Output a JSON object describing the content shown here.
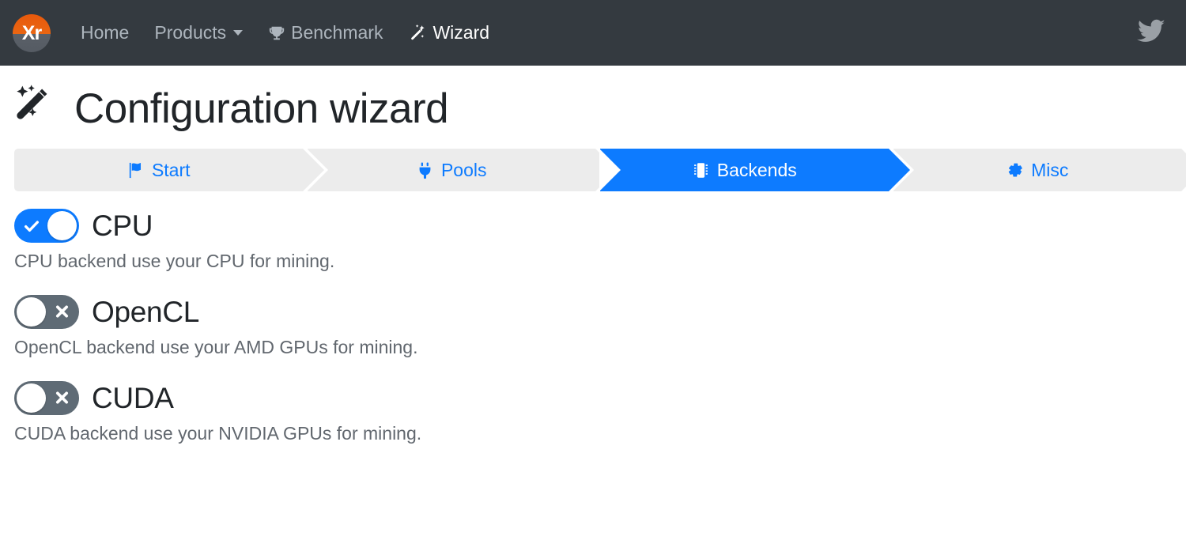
{
  "navbar": {
    "brand": {
      "text": "Xr",
      "icon": "xmrig-logo-icon"
    },
    "links": [
      {
        "label": "Home",
        "icon": null,
        "active": false
      },
      {
        "label": "Products",
        "icon": "chevron-down-icon",
        "active": false
      },
      {
        "label": "Benchmark",
        "icon": "trophy-icon",
        "active": false
      },
      {
        "label": "Wizard",
        "icon": "magic-wand-icon",
        "active": true
      }
    ],
    "social": {
      "icon": "twitter-icon",
      "label": "Twitter"
    },
    "colors": {
      "background": "#343a40",
      "link": "#adb5bd",
      "link_active": "#ffffff"
    }
  },
  "page": {
    "title": "Configuration wizard",
    "title_icon": "magic-wand-icon"
  },
  "stepper": {
    "steps": [
      {
        "label": "Start",
        "icon": "flag-icon",
        "active": false
      },
      {
        "label": "Pools",
        "icon": "plug-icon",
        "active": false
      },
      {
        "label": "Backends",
        "icon": "memory-chip-icon",
        "active": true
      },
      {
        "label": "Misc",
        "icon": "gear-icon",
        "active": false
      }
    ],
    "colors": {
      "inactive_bg": "#ececec",
      "active_bg": "#0d7bff",
      "inactive_text": "#0d7bff",
      "active_text": "#ffffff"
    }
  },
  "backends": [
    {
      "name": "CPU",
      "enabled": true,
      "toggle_icon": "check-icon",
      "description": "CPU backend use your CPU for mining."
    },
    {
      "name": "OpenCL",
      "enabled": false,
      "toggle_icon": "cross-icon",
      "description": "OpenCL backend use your AMD GPUs for mining."
    },
    {
      "name": "CUDA",
      "enabled": false,
      "toggle_icon": "cross-icon",
      "description": "CUDA backend use your NVIDIA GPUs for mining."
    }
  ],
  "colors": {
    "accent": "#0d7bff",
    "toggle_off": "#5f6b75",
    "text_primary": "#212529",
    "text_muted": "#61676e",
    "page_bg": "#ffffff"
  }
}
